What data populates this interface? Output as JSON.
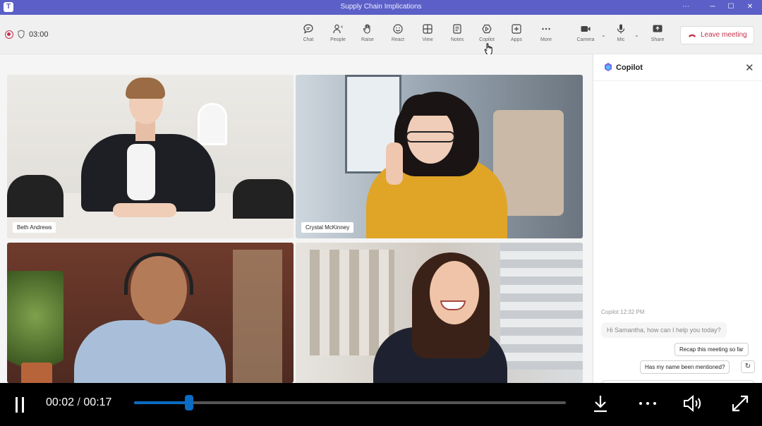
{
  "window": {
    "title": "Supply Chain Implications",
    "logo": "T"
  },
  "toolbar": {
    "timer": "03:00",
    "buttons": [
      {
        "id": "chat",
        "label": "Chat",
        "icon": "chat-icon"
      },
      {
        "id": "people",
        "label": "People",
        "icon": "people-icon"
      },
      {
        "id": "raise",
        "label": "Raise",
        "icon": "hand-icon"
      },
      {
        "id": "react",
        "label": "React",
        "icon": "smiley-icon"
      },
      {
        "id": "view",
        "label": "View",
        "icon": "grid-icon"
      },
      {
        "id": "notes",
        "label": "Notes",
        "icon": "notes-icon"
      },
      {
        "id": "copilot",
        "label": "Copilot",
        "icon": "copilot-icon"
      },
      {
        "id": "apps",
        "label": "Apps",
        "icon": "plus-icon"
      },
      {
        "id": "more",
        "label": "More",
        "icon": "ellipsis-icon"
      },
      {
        "id": "camera",
        "label": "Camera",
        "icon": "camera-icon"
      },
      {
        "id": "mic",
        "label": "Mic",
        "icon": "mic-icon"
      },
      {
        "id": "share",
        "label": "Share",
        "icon": "share-icon"
      }
    ],
    "leave_label": "Leave meeting"
  },
  "participants": [
    {
      "name": "Beth Andrews"
    },
    {
      "name": "Crystal McKinney"
    },
    {
      "name": ""
    },
    {
      "name": ""
    }
  ],
  "copilot": {
    "title": "Copilot",
    "meta": "Copilot  12:32 PM",
    "greeting": "Hi Samantha, how can I help you today?",
    "suggestions": [
      "Recap this meeting so far",
      "Has my name been mentioned?"
    ]
  },
  "player": {
    "current": "00:02",
    "separator": "/",
    "duration": "00:17",
    "progress": 0.1275
  },
  "colors": {
    "brand": "#5b5fc7",
    "leave": "#c4314b",
    "progress": "#0b6cc4"
  }
}
